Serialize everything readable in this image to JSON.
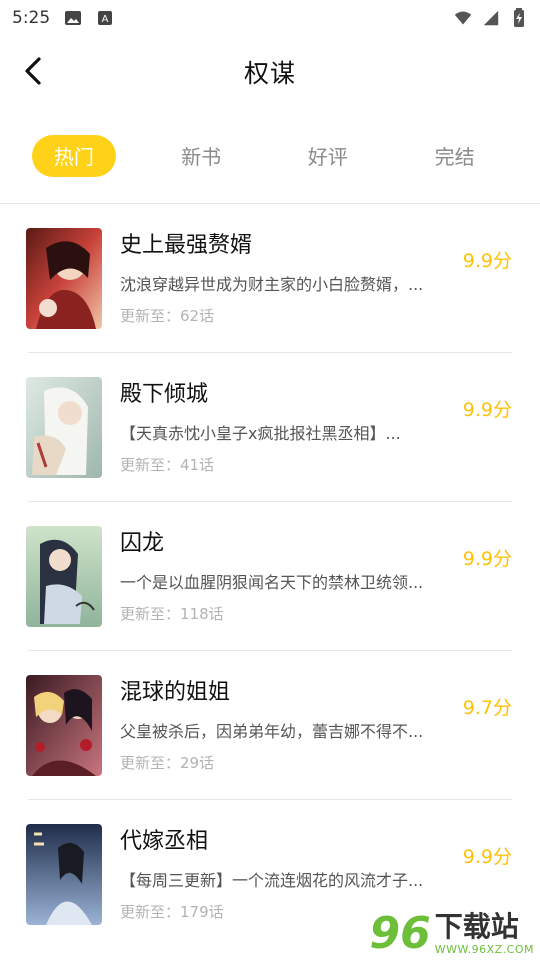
{
  "status_bar": {
    "time": "5:25",
    "icons": [
      "image-icon",
      "keyboard-icon",
      "wifi-icon",
      "signal-icon",
      "battery-icon"
    ]
  },
  "header": {
    "title": "权谋",
    "back_icon": "chevron-left-icon"
  },
  "tabs": [
    {
      "label": "热门",
      "active": true
    },
    {
      "label": "新书",
      "active": false
    },
    {
      "label": "好评",
      "active": false
    },
    {
      "label": "完结",
      "active": false
    }
  ],
  "list": [
    {
      "name": "史上最强赘婿",
      "desc": "沈浪穿越异世成为财主家的小白脸赘婿，...",
      "update": "更新至：62话",
      "score": "9.9分"
    },
    {
      "name": "殿下倾城",
      "desc": "【天真赤忱小皇子x疯批报社黑丞相】...",
      "update": "更新至：41话",
      "score": "9.9分"
    },
    {
      "name": "囚龙",
      "desc": "一个是以血腥阴狠闻名天下的禁林卫统领...",
      "update": "更新至：118话",
      "score": "9.9分"
    },
    {
      "name": "混球的姐姐",
      "desc": "父皇被杀后，因弟弟年幼，蕾吉娜不得不...",
      "update": "更新至：29话",
      "score": "9.7分"
    },
    {
      "name": "代嫁丞相",
      "desc": "【每周三更新】一个流连烟花的风流才子...",
      "update": "更新至：179话",
      "score": "9.9分"
    }
  ],
  "watermark": {
    "brand": "96",
    "title": "下载站",
    "url": "WWW.96XZ.COM"
  },
  "colors": {
    "accent": "#ffd21a",
    "score": "#ffc107"
  }
}
